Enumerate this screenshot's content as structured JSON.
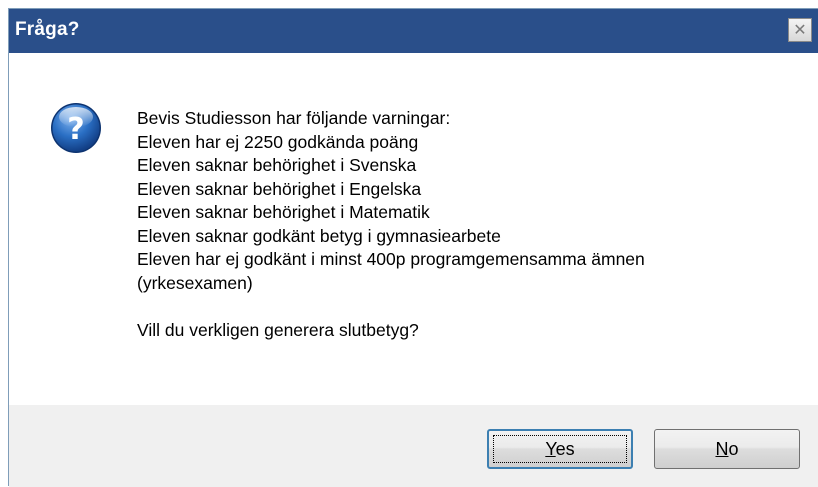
{
  "window": {
    "title": "Fråga?"
  },
  "dialog": {
    "icon": "question-icon",
    "lines": [
      "Bevis Studiesson har följande varningar:",
      "Eleven har ej 2250 godkända poäng",
      "Eleven saknar behörighet i Svenska",
      "Eleven saknar behörighet i Engelska",
      "Eleven saknar behörighet i Matematik",
      "Eleven saknar godkänt betyg i gymnasiearbete",
      "Eleven har ej godkänt i minst 400p programgemensamma ämnen",
      "(yrkesexamen)"
    ],
    "question": "Vill du verkligen generera slutbetyg?"
  },
  "buttons": {
    "yes": {
      "mnemonic": "Y",
      "rest": "es"
    },
    "no": {
      "mnemonic": "N",
      "rest": "o"
    }
  },
  "colors": {
    "titlebar": "#2a4f8a",
    "footer": "#f0f0f0",
    "icon_blue": "#1f5fb0"
  }
}
